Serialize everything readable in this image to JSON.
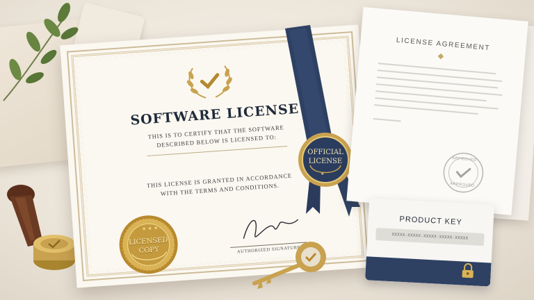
{
  "certificate": {
    "title": "SOFTWARE LICENSE",
    "line1a": "THIS IS TO CERTIFY THAT THE SOFTWARE",
    "line1b": "DESCRIBED BELOW IS LICENSED TO:",
    "line2a": "THIS LICENSE IS GRANTED IN ACCORDANCE",
    "line2b": "WITH THE TERMS AND CONDITIONS.",
    "seal_line1": "LICENSED",
    "seal_line2": "COPY",
    "signature_label": "AUTHORIZED SIGNATURE"
  },
  "ribbon_seal": {
    "line1": "OFFICIAL",
    "line2": "LICENSE"
  },
  "agreement": {
    "title": "LICENSE AGREEMENT",
    "stamp_top": "APPROVED",
    "stamp_bottom": "APPROVED"
  },
  "product_card": {
    "title": "PRODUCT KEY",
    "key_value": "XXXXX-XXXXX-XXXXX-XXXXX-XXXXX"
  },
  "colors": {
    "navy": "#2e4163",
    "gold": "#c9a24f",
    "paper": "#fbf8f1"
  },
  "icons": [
    "laurel-check-icon",
    "gold-seal-icon",
    "ribbon-icon",
    "lock-icon",
    "approved-stamp-icon",
    "wax-stamp-icon",
    "key-icon",
    "leaf-branch-icon"
  ]
}
